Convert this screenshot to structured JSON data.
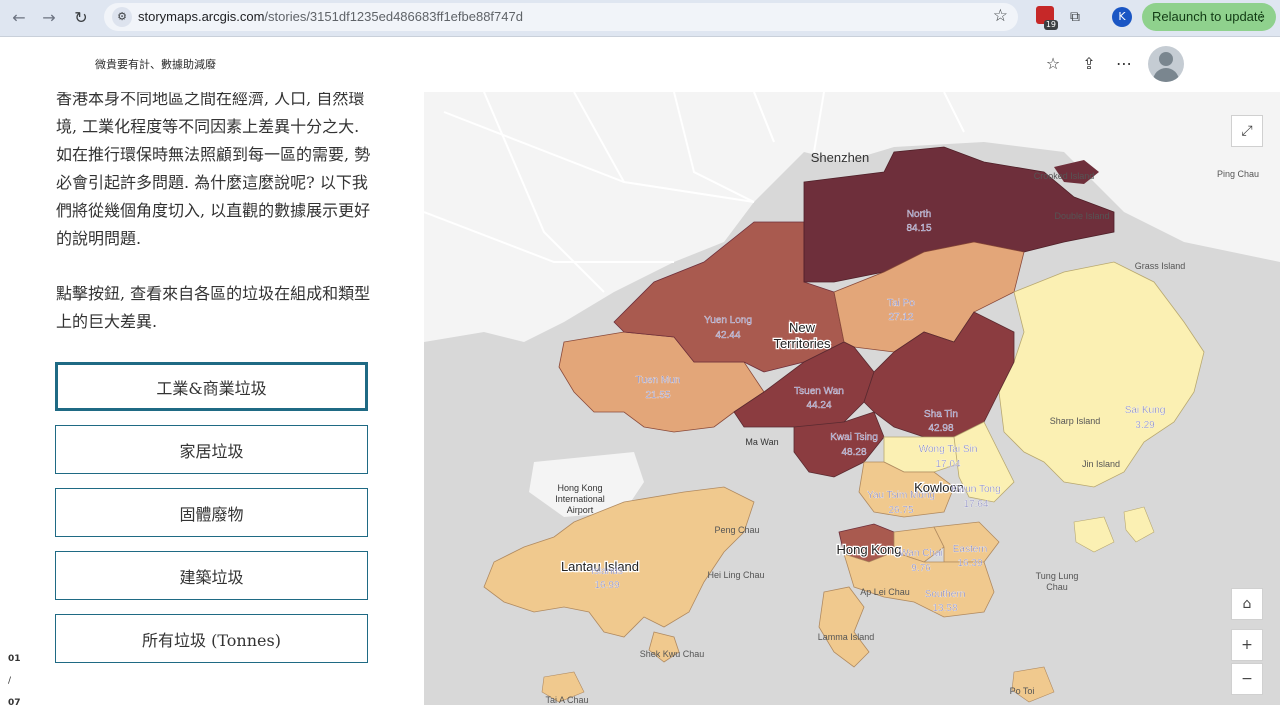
{
  "browser": {
    "url_host": "storymaps.arcgis.com",
    "url_path": "/stories/3151df1235ed486683ff1efbe88f747d",
    "extension_badge": "19",
    "profile_initial": "K",
    "relaunch_label": "Relaunch to update"
  },
  "header": {
    "title": "微貴要有計、數據助減廢"
  },
  "panel": {
    "paragraph1": "香港本身不同地區之間在經濟, 人口, 自然環境, 工業化程度等不同因素上差異十分之大. 如在推行環保時無法照顧到每一區的需要, 勢必會引起許多問題. 為什麼這麼說呢? 以下我們將從幾個角度切入, 以直觀的數據展示更好的說明問題.",
    "paragraph2": "點擊按鈕, 查看來自各區的垃圾在組成和類型上的巨大差異.",
    "buttons": [
      {
        "label": "工業&商業垃圾",
        "active": true
      },
      {
        "label": "家居垃圾",
        "active": false
      },
      {
        "label": "固體廢物",
        "active": false
      },
      {
        "label": "建築垃圾",
        "active": false
      },
      {
        "label": "所有垃圾 (Tonnes)",
        "active": false
      }
    ],
    "pager": {
      "current": "01",
      "sep": "/",
      "total": "07"
    }
  },
  "map": {
    "colors": {
      "darkest": "#6e2f3b",
      "dark": "#8b3c40",
      "mid_dark": "#a95a4f",
      "mid": "#c8795c",
      "light": "#e3a679",
      "lighter": "#f0c98e",
      "lightest": "#fbf0b3",
      "land": "#f4f4f4",
      "water": "#d8d8d8"
    },
    "districts": [
      {
        "name": "North",
        "value": "84.15",
        "color": "darkest"
      },
      {
        "name": "Yuen Long",
        "value": "42.44",
        "color": "mid_dark"
      },
      {
        "name": "Tai Po",
        "value": "27.12",
        "color": "light"
      },
      {
        "name": "Tuen Mun",
        "value": "21.55",
        "color": "light"
      },
      {
        "name": "Tsuen Wan",
        "value": "44.24",
        "color": "dark"
      },
      {
        "name": "Sha Tin",
        "value": "42.98",
        "color": "dark"
      },
      {
        "name": "Kwai Tsing",
        "value": "48.28",
        "color": "dark"
      },
      {
        "name": "Wong Tai Sin",
        "value": "17.04",
        "color": "lightest"
      },
      {
        "name": "Kwun Tong",
        "value": "17.64",
        "color": "lightest"
      },
      {
        "name": "Sai Kung",
        "value": "3.29",
        "color": "lightest"
      },
      {
        "name": "Yau Tsim Mong",
        "value": "26.75",
        "color": "lighter"
      },
      {
        "name": "Wan Chai",
        "value": "9.76",
        "color": "lighter"
      },
      {
        "name": "Eastern",
        "value": "16.39",
        "color": "lighter"
      },
      {
        "name": "Southern",
        "value": "13.58",
        "color": "lighter"
      },
      {
        "name": "Islands",
        "value": "16.99",
        "color": "lighter"
      }
    ],
    "place_labels": [
      "Shenzhen",
      "New",
      "Territories",
      "Kowloon",
      "Hong Kong",
      "Lantau Island",
      "Crooked Island",
      "Double Island",
      "Grass Island",
      "Ping Chau",
      "Sharp Island",
      "Jin Island",
      "Ma Wan",
      "Hong Kong",
      "International",
      "Airport",
      "Peng Chau",
      "Hei Ling Chau",
      "Ap Lei Chau",
      "Lamma Island",
      "Shek Kwu Chau",
      "Tung Lung",
      "Chau",
      "Po Toi",
      "Tai A Chau"
    ],
    "controls": {
      "expand_icon": "expand-icon",
      "home_icon": "home-icon",
      "zoom_in": "+",
      "zoom_out": "−"
    }
  }
}
